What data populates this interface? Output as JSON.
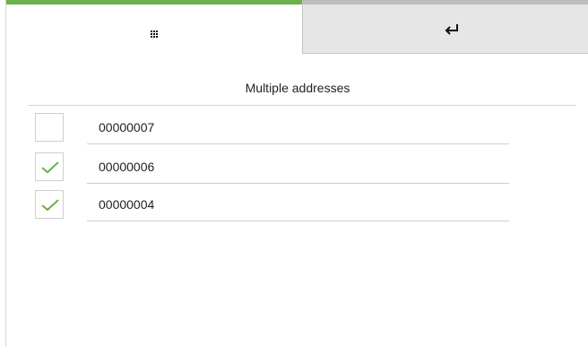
{
  "tabs": {
    "grid_icon": "grid-icon",
    "back_icon": "return-arrow-icon",
    "active_color": "#6ab04c"
  },
  "title": "Multiple addresses",
  "addresses": [
    {
      "label": "00000007",
      "checked": false
    },
    {
      "label": "00000006",
      "checked": true
    },
    {
      "label": "00000004",
      "checked": true
    }
  ],
  "check_color": "#6ab04c"
}
